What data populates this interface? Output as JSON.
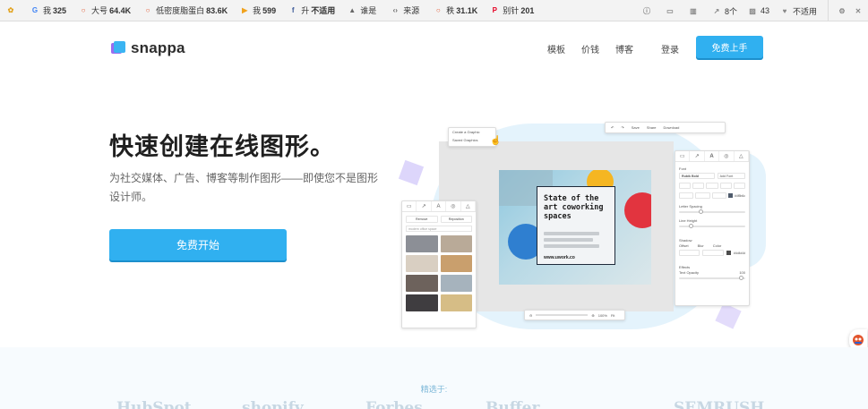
{
  "seo_bar": {
    "items": [
      {
        "icon": "google-icon",
        "glyph": "G",
        "color": "#4285f4",
        "label": "我",
        "value": "325"
      },
      {
        "icon": "circle-icon",
        "glyph": "○",
        "color": "#e2552d",
        "label": "大号",
        "value": "64.4K"
      },
      {
        "icon": "circle-icon",
        "glyph": "○",
        "color": "#e2552d",
        "label": "低密度脂蛋白",
        "value": "83.6K"
      },
      {
        "icon": "play-icon",
        "glyph": "▶",
        "color": "#f0a21d",
        "label": "我",
        "value": "599"
      },
      {
        "icon": "facebook-icon",
        "glyph": "f",
        "color": "#3b5998",
        "label": "升",
        "value": "不适用"
      },
      {
        "icon": "person-icon",
        "glyph": "▲",
        "color": "#666666",
        "label": "谁是",
        "value": ""
      },
      {
        "icon": "code-icon",
        "glyph": "‹›",
        "color": "#666666",
        "label": "来源",
        "value": ""
      },
      {
        "icon": "circle-icon",
        "glyph": "○",
        "color": "#e2552d",
        "label": "秩",
        "value": "31.1K"
      },
      {
        "icon": "pinterest-icon",
        "glyph": "P",
        "color": "#e60023",
        "label": "别针",
        "value": "201"
      }
    ],
    "right": [
      {
        "icon": "info-icon",
        "label": ""
      },
      {
        "icon": "screen-icon",
        "label": ""
      },
      {
        "icon": "bookmark-icon",
        "label": ""
      },
      {
        "icon": "external-link-icon",
        "label": "8个"
      },
      {
        "icon": "image-icon",
        "label": "43"
      },
      {
        "icon": "heart-icon",
        "label": "不适用"
      }
    ]
  },
  "header": {
    "logo_text": "snappa",
    "nav": [
      "模板",
      "价钱",
      "博客"
    ],
    "login": "登录",
    "signup": "免费上手"
  },
  "hero": {
    "title": "快速创建在线图形。",
    "subtitle": "为社交媒体、广告、博客等制作图形——即使您不是图形设计师。",
    "cta": "免费开始"
  },
  "illustration": {
    "create_menu": [
      "Create a Graphic",
      "Saved Graphics"
    ],
    "toolbar": [
      "Save",
      "Share",
      "Download"
    ],
    "left_panel_buttons": [
      "Remove",
      "Reposition"
    ],
    "search_placeholder": "modern office space",
    "art_title": "State of the art coworking spaces",
    "art_url": "www.uwork.co",
    "right_panel": {
      "font_label": "Font",
      "font_name": "Rubik Bold",
      "add_font": "Add Font",
      "color_hex": "#4f5b6c",
      "letter_spacing": "Letter Spacing",
      "line_height": "Line Height",
      "shadow": "Shadow",
      "offset": "Offset",
      "blur": "Blur",
      "color": "Color",
      "shadow_hex": "#4d4d4d",
      "effects": "Effects",
      "text_opacity": "Text Opacity",
      "opacity_value": "100"
    },
    "zoom_value": "100%",
    "zoom_fit": "Fit"
  },
  "bottom": {
    "featured_label": "精选于:",
    "brands": [
      "HubSpot",
      "shopify",
      "Forbes",
      "Buffer",
      "SEMRUSH"
    ]
  },
  "colors": {
    "accent": "#30b0f0",
    "art_yellow": "#f5b622",
    "art_red": "#e2343f",
    "art_blue": "#2f7fd0"
  }
}
